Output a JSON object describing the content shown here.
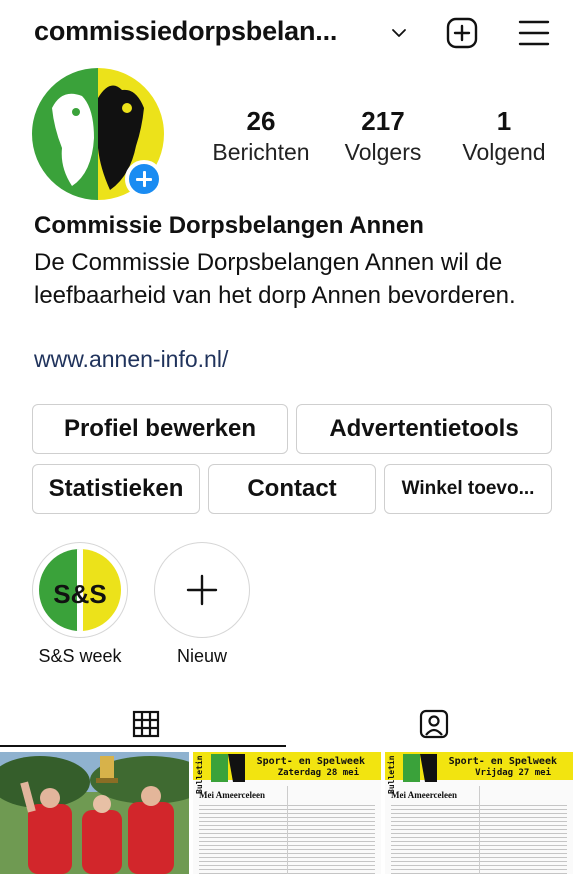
{
  "header": {
    "username": "commissiedorpsbelan...",
    "icons": [
      "chevron-down-icon",
      "new-post-icon",
      "menu-icon"
    ]
  },
  "profile": {
    "stats": [
      {
        "value": "26",
        "label": "Berichten"
      },
      {
        "value": "217",
        "label": "Volgers"
      },
      {
        "value": "1",
        "label": "Volgend"
      }
    ],
    "name": "Commissie Dorpsbelangen Annen",
    "bio": "De Commissie Dorpsbelangen Annen wil de leefbaarheid van het dorp Annen bevorderen.",
    "link": "www.annen-info.nl/"
  },
  "buttons": {
    "edit_profile": "Profiel bewerken",
    "ad_tools": "Advertentietools",
    "statistics": "Statistieken",
    "contact": "Contact",
    "shop": "Winkel toevo..."
  },
  "highlights": [
    {
      "label": "S&S week",
      "cover_text": "S&S"
    },
    {
      "label": "Nieuw"
    }
  ],
  "tabs": [
    "grid-icon",
    "tagged-icon"
  ],
  "posts": [
    {
      "type": "photo"
    },
    {
      "type": "bulletin",
      "side": "Bulletin",
      "title": "Sport- en Spelweek",
      "date": "Zaterdag 28 mei",
      "heading": "Mei Ameerceleen"
    },
    {
      "type": "bulletin",
      "side": "Bulletin",
      "title": "Sport- en Spelweek",
      "date": "Vrijdag 27 mei",
      "heading": "Mei Ameerceleen"
    }
  ],
  "colors": {
    "accent_blue": "#1a8cf2",
    "link": "#20335c",
    "logo_green": "#3aa23a",
    "logo_yellow": "#ece21a"
  }
}
